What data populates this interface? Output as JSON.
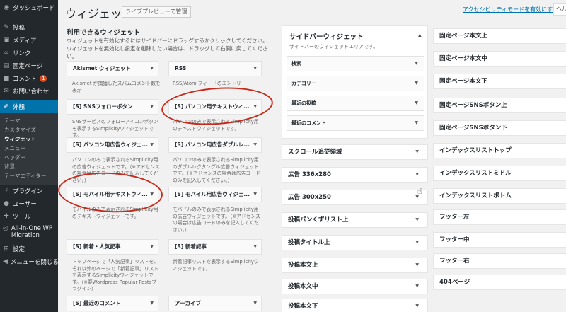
{
  "sidebar": {
    "dashboard": "ダッシュボード",
    "items": [
      {
        "label": "投稿",
        "icon": "pin-icon"
      },
      {
        "label": "メディア",
        "icon": "media-icon"
      },
      {
        "label": "リンク",
        "icon": "link-icon"
      },
      {
        "label": "固定ページ",
        "icon": "page-icon"
      },
      {
        "label": "コメント",
        "icon": "comment-icon",
        "badge": "1"
      },
      {
        "label": "お問い合わせ",
        "icon": "mail-icon"
      }
    ],
    "appearance": "外観",
    "submenu": [
      "テーマ",
      "カスタマイズ",
      "ウィジェット",
      "メニュー",
      "ヘッダー",
      "背景",
      "テーマエディター"
    ],
    "items2": [
      {
        "label": "プラグイン",
        "icon": "plugin-icon"
      },
      {
        "label": "ユーザー",
        "icon": "user-icon"
      },
      {
        "label": "ツール",
        "icon": "tool-icon"
      },
      {
        "label": "All-in-One WP Migration",
        "icon": "migration-icon"
      },
      {
        "label": "設定",
        "icon": "settings-icon"
      },
      {
        "label": "メニューを閉じる",
        "icon": "collapse-icon"
      }
    ]
  },
  "header": {
    "title": "ウィジェット",
    "live_preview": "ライブプレビューで管理",
    "a11y_link": "アクセシビリティモードを有効にする",
    "help": "ヘル"
  },
  "available": {
    "title": "利用できるウィジェット",
    "description": "ウィジェットを有効化するにはサイドバーにドラッグするかクリックしてください。ウィジェットを無効化し設定を削除したい場合は、ドラッグして右側に戻してください。",
    "widgets": [
      {
        "name": "Akismet ウィジェット",
        "desc": "Akismet が捕獲したスパムコメント数を表示"
      },
      {
        "name": "RSS",
        "desc": "RSS/Atom フィードのエントリー"
      },
      {
        "name": "[S] SNSフォローボタン",
        "desc": "SNSサービスのフォローアイコンボタンを表示するSimplicityウィジェットです。"
      },
      {
        "name": "[S] パソコン用テキストウィ...",
        "desc": "パソコンのみで表示されるSimplicity用のテキストウィジェットです。"
      },
      {
        "name": "[S] パソコン用広告ウィジェ...",
        "desc": "パソコンのみで表示されるSimplicity用の広告ウィジェットです。（※アドセンスの場合は広告コードのみを記入してください。）"
      },
      {
        "name": "[S] パソコン用広告ダブルレ...",
        "desc": "パソコンのみで表示されるSimplicity用のダブルレクタングル広告ウィジェットです。（※アドセンスの場合は広告コードのみを記入してください。）"
      },
      {
        "name": "[S] モバイル用テキストウィ...",
        "desc": "モバイルのみで表示されるSimplicity用のテキストウィジェットです。"
      },
      {
        "name": "[S] モバイル用広告ウィジェ...",
        "desc": "モバイルのみで表示されるSimplicity用の広告ウィジェットです。（※アドセンスの場合は広告コードのみを記入してください。）"
      },
      {
        "name": "[S] 新着・人気記事",
        "desc": "トップページで「人気記事」リストを、それ以外のページで「新着記事」リストを表示するSimplicityウィジェットです。（※要Wordpress Popular Postsプラグイン）"
      },
      {
        "name": "[S] 新着記事",
        "desc": "新着記事リストを表示するSimplicityウィジェットです。"
      },
      {
        "name": "[S] 最近のコメント",
        "desc": ""
      },
      {
        "name": "アーカイブ",
        "desc": ""
      }
    ]
  },
  "sidebar_area": {
    "title": "サイドバーウィジェット",
    "description": "サイドバーのウィジェットエリアです。",
    "widgets": [
      "検索",
      "カテゴリー",
      "最近の投稿",
      "最近のコメント"
    ]
  },
  "middle_areas": [
    "スクロール追従領域",
    "広告 336x280",
    "広告 300x250",
    "投稿パンくずリスト上",
    "投稿タイトル上",
    "投稿本文上",
    "投稿本文中",
    "投稿本文下"
  ],
  "right_areas": [
    "固定ページ本文上",
    "固定ページ本文中",
    "固定ページ本文下",
    "固定ページSNSボタン上",
    "固定ページSNSボタン下",
    "インデックスリストトップ",
    "インデックスリストミドル",
    "インデックスリストボトム",
    "フッター左",
    "フッター中",
    "フッター右",
    "404ページ"
  ],
  "colors": {
    "sidebar_bg": "#23282d",
    "accent": "#0073aa",
    "annotation": "#c62b1c"
  }
}
